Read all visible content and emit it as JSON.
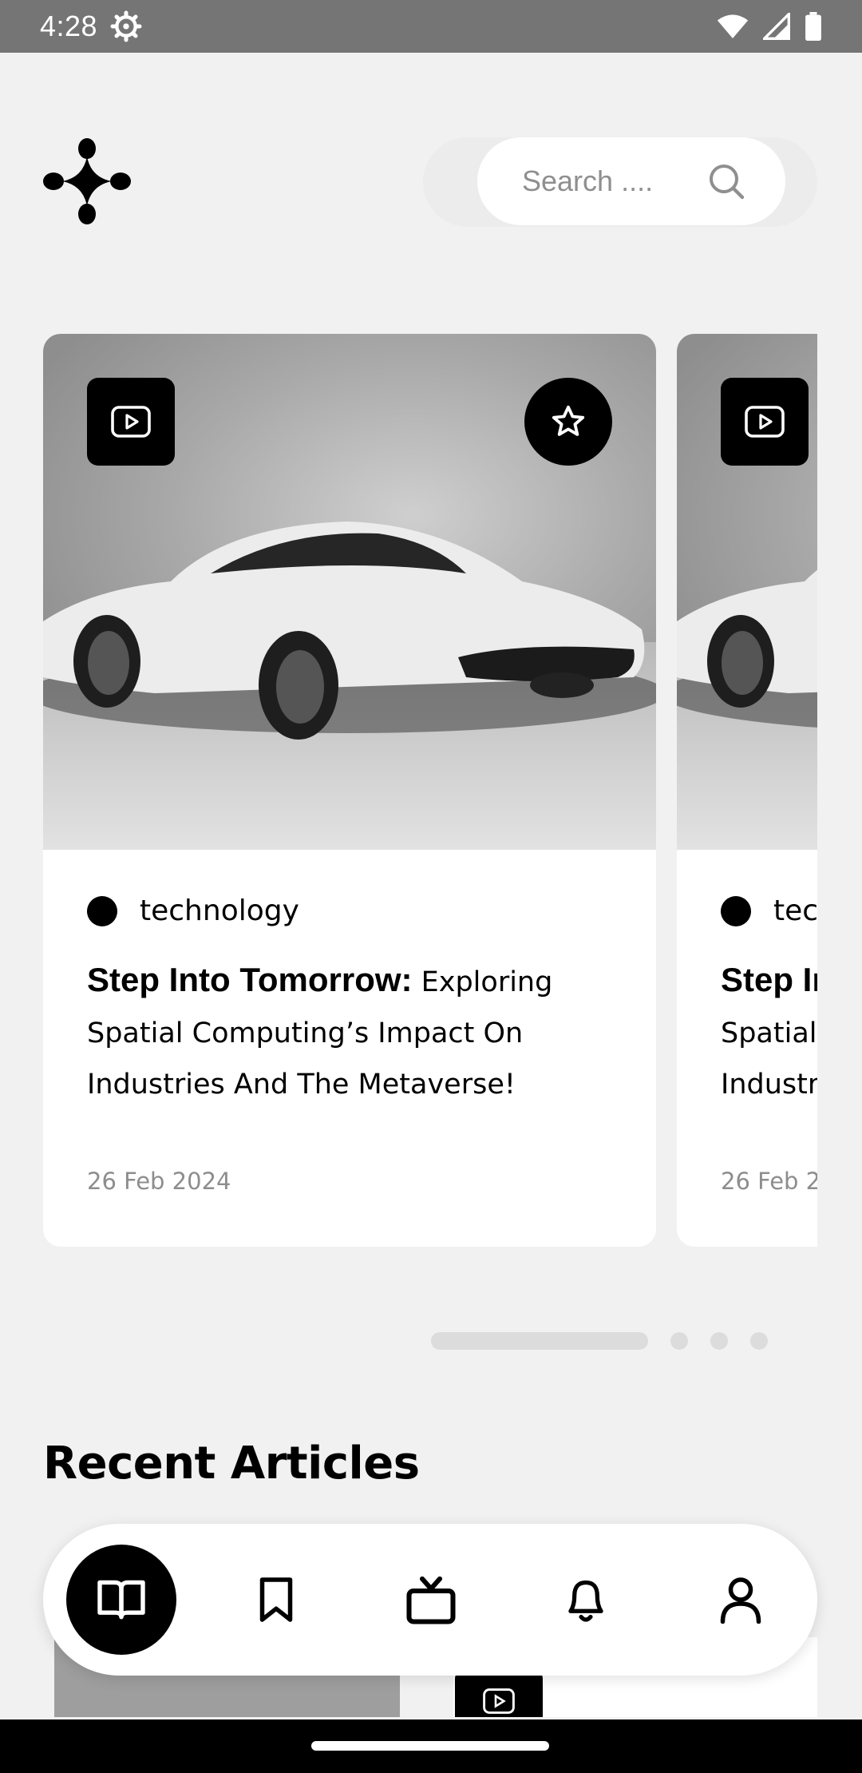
{
  "status_bar": {
    "time": "4:28"
  },
  "search": {
    "placeholder": "Search ...."
  },
  "cards": [
    {
      "category": "technology",
      "headline_bold": "Step Into Tomorrow:",
      "headline_line1": " Exploring",
      "headline_line2": "Spatial Computing’s Impact On",
      "headline_line3": "Industries And The Metaverse!",
      "date": "26 Feb 2024"
    },
    {
      "category": "tec",
      "headline_bold": "Step In",
      "headline_line2": "Spatial",
      "headline_line3": "Industr",
      "date": "26 Feb 2"
    }
  ],
  "pager": {
    "count": 4,
    "active": 0
  },
  "section": {
    "recent_title": "Recent Articles"
  },
  "nav": {
    "items": [
      "read-icon",
      "bookmark-icon",
      "tv-icon",
      "bell-icon",
      "profile-icon"
    ],
    "active": 0
  }
}
